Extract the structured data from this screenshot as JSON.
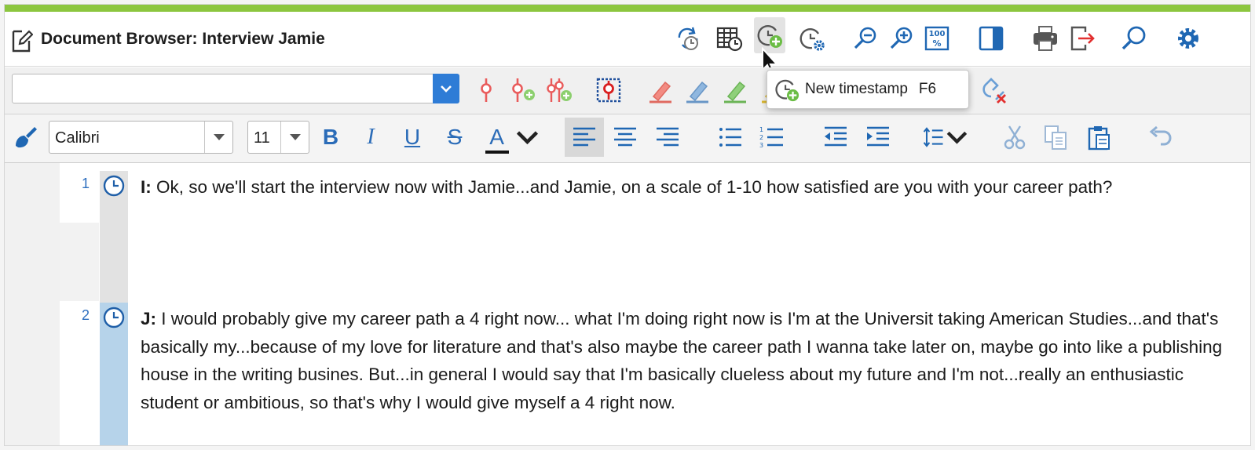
{
  "window": {
    "title": "Document Browser: Interview Jamie",
    "accent_color": "#8cc63f",
    "title_icon": "edit-document-icon"
  },
  "toolbar": {
    "icons": [
      "refresh-timestamps-icon",
      "timestamp-table-icon",
      "new-timestamp-icon",
      "timestamp-settings-icon",
      "zoom-out-icon",
      "zoom-in-icon",
      "zoom-100-icon",
      "panel-toggle-icon",
      "print-icon",
      "export-icon",
      "search-icon",
      "settings-gear-icon"
    ]
  },
  "tooltip": {
    "label": "New timestamp",
    "shortcut": "F6"
  },
  "code_bar": {
    "code_value": "",
    "icons": [
      "code-icon",
      "code-new-icon",
      "code-multiple-icon",
      "code-selection-icon",
      "highlighter-red-icon",
      "highlighter-blue-icon",
      "highlighter-green-icon",
      "highlighter-yellow-icon",
      "remove-code-icon"
    ]
  },
  "format_bar": {
    "font_family": "Calibri",
    "font_size": "11",
    "bold": "B",
    "italic": "I",
    "underline": "U",
    "strike": "S",
    "font_color": "A",
    "icons": [
      "format-painter-icon",
      "align-left-icon",
      "align-center-icon",
      "align-right-icon",
      "bullet-list-icon",
      "numbered-list-icon",
      "outdent-icon",
      "indent-icon",
      "line-spacing-icon",
      "cut-icon",
      "copy-icon",
      "paste-icon",
      "undo-icon"
    ]
  },
  "paragraphs": [
    {
      "number": "1",
      "speaker": "I:",
      "text": " Ok, so we'll start the interview now with Jamie...and Jamie, on a scale of 1-10 how satisfied are you with your career path?"
    },
    {
      "number": "2",
      "speaker": "J:",
      "text": " I would probably give my career path a 4 right now... what I'm doing right now is I'm at the Universit taking American Studies...and that's basically my...because of my love for literature and that's also maybe the career path I wanna take later on, maybe go into like a publishing house in the writing busines. But...in general I would say that I'm basically clueless about my future and I'm not...really an enthusiastic student or ambitious, so that's why I would give myself a 4 right now."
    }
  ],
  "colors": {
    "icon_blue": "#1f67b3",
    "timestamp_col_1": "#e2e2e2",
    "timestamp_col_2": "#b6d3ea",
    "highlight_red": "#f28b82",
    "highlight_blue": "#8fb7df",
    "highlight_green": "#8fd07a"
  }
}
